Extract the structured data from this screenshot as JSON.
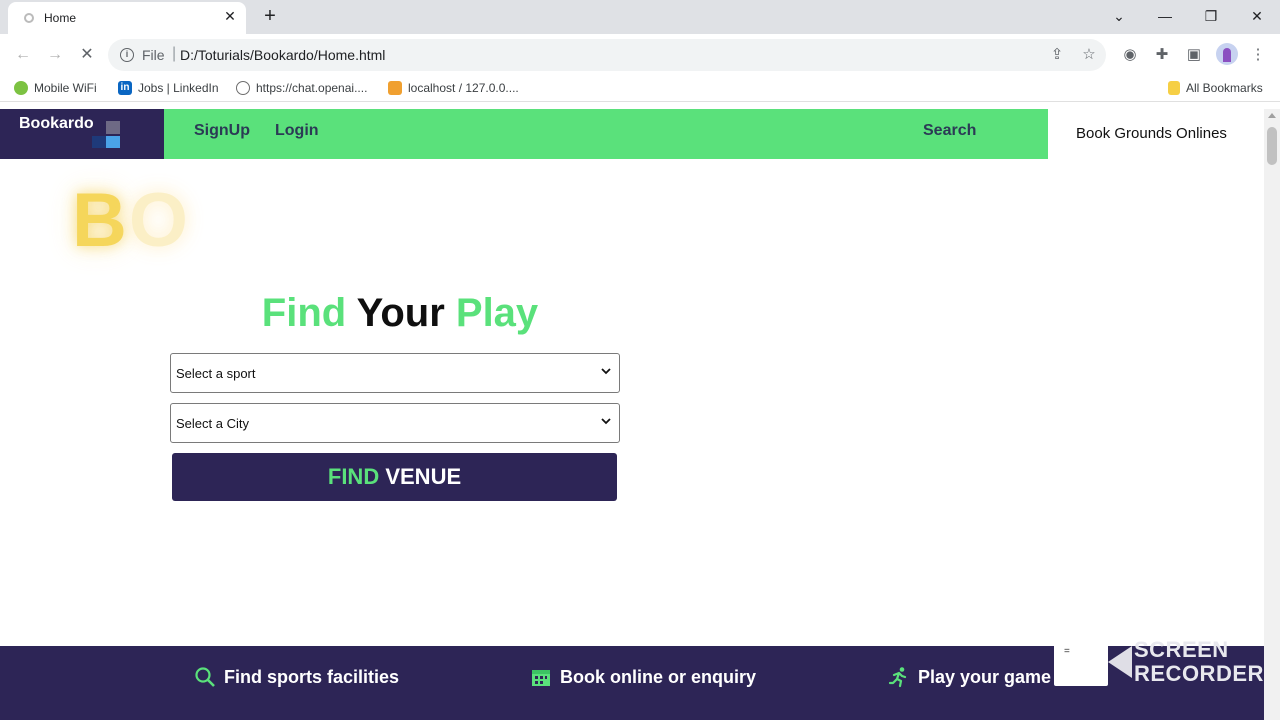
{
  "browser": {
    "tab_title": "Home",
    "tab_close": "✕",
    "new_tab": "+",
    "window_controls": [
      "⌄",
      "—",
      "❐",
      "✕"
    ],
    "url_scheme_label": "File",
    "url_separator": "|",
    "url": "D:/Toturials/Bookardo/Home.html",
    "bookmarks": [
      {
        "label": "Mobile WiFi",
        "icon": "wifi-icon",
        "color": "#7cc242"
      },
      {
        "label": "Jobs | LinkedIn",
        "icon": "linkedin-icon",
        "color": "#0a66c2"
      },
      {
        "label": "https://chat.openai....",
        "icon": "openai-icon",
        "color": "#6e6e6e"
      },
      {
        "label": "localhost / 127.0.0....",
        "icon": "phpmyadmin-icon",
        "color": "#f0a030"
      }
    ],
    "all_bookmarks_label": "All Bookmarks"
  },
  "site": {
    "logo_text": "Bookardo",
    "nav": {
      "signup": "SignUp",
      "login": "Login",
      "search": "Search"
    },
    "header_tagline": "Book Grounds Onlines",
    "hero_logo": {
      "b": "B",
      "o": "O"
    },
    "title": {
      "find": "Find",
      "your": "Your",
      "play": "Play"
    },
    "sport_select": {
      "selected": "Select a sport"
    },
    "city_select": {
      "selected": "Select a City"
    },
    "find_button": {
      "find": "FIND",
      "venue": "VENUE"
    },
    "features": [
      {
        "label": "Find sports facilities",
        "icon": "search-icon"
      },
      {
        "label": "Book online or enquiry",
        "icon": "calendar-icon"
      },
      {
        "label": "Play your game",
        "icon": "runner-icon"
      }
    ]
  },
  "overlay": {
    "recorder_line1": "SCREEN",
    "recorder_line2": "RECORDER",
    "recorder_mark": "="
  },
  "colors": {
    "brand_dark": "#2d2556",
    "brand_green": "#5ae17b"
  }
}
